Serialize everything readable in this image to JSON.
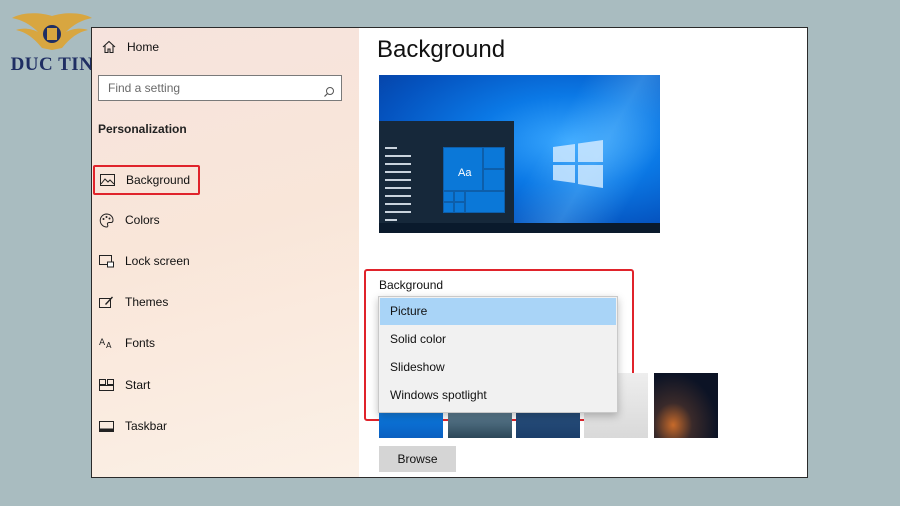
{
  "logo": {
    "text": "DUC TIN"
  },
  "sidebar": {
    "home_label": "Home",
    "search_placeholder": "Find a setting",
    "section_title": "Personalization",
    "items": [
      {
        "label": "Background",
        "icon": "picture-icon",
        "selected": true
      },
      {
        "label": "Colors",
        "icon": "palette-icon"
      },
      {
        "label": "Lock screen",
        "icon": "lock-screen-icon"
      },
      {
        "label": "Themes",
        "icon": "themes-icon"
      },
      {
        "label": "Fonts",
        "icon": "fonts-icon"
      },
      {
        "label": "Start",
        "icon": "start-icon"
      },
      {
        "label": "Taskbar",
        "icon": "taskbar-icon"
      }
    ]
  },
  "main": {
    "title": "Background",
    "preview_tile_text": "Aa",
    "background_label": "Background",
    "dropdown_options": [
      "Picture",
      "Solid color",
      "Slideshow",
      "Windows spotlight"
    ],
    "selected_option": "Picture",
    "browse_label": "Browse"
  },
  "colors": {
    "highlight": "#e0232b",
    "selected_option_bg": "#a9d4f7",
    "page_bg": "#a9bcc0"
  }
}
